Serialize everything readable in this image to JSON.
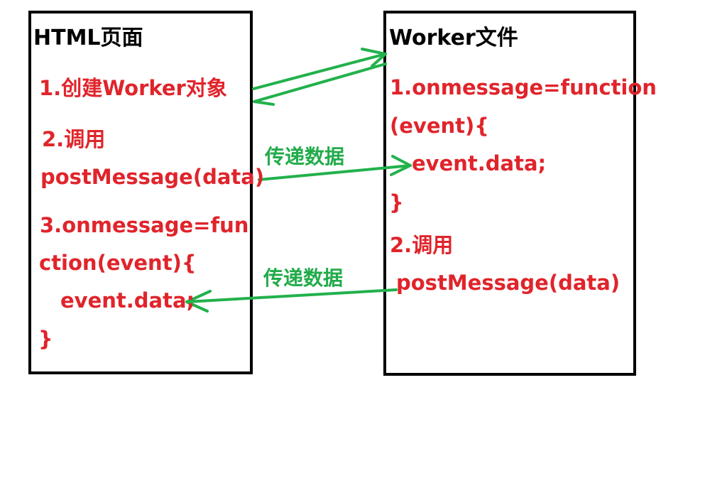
{
  "html_page": {
    "title": "HTML页面",
    "step1": "1.创建Worker对象",
    "step2_line1": "2.调用",
    "step2_line2": "postMessage(data)",
    "step3_line1": "3.onmessage=fun",
    "step3_line2": "ction(event){",
    "step3_line3": "event.data;",
    "step3_line4": "}"
  },
  "worker_file": {
    "title": "Worker文件",
    "step1_line1": "1.onmessage=function",
    "step1_line2": "(event){",
    "step1_line3": "event.data;",
    "step1_line4": "}",
    "step2_line1": "2.调用",
    "step2_line2": "postMessage(data)"
  },
  "arrows": {
    "label_to_worker": "传递数据",
    "label_to_page": "传递数据"
  },
  "colors": {
    "box_border": "#000000",
    "code_text": "#e0242b",
    "arrow": "#22b14c",
    "title_text": "#000000"
  }
}
